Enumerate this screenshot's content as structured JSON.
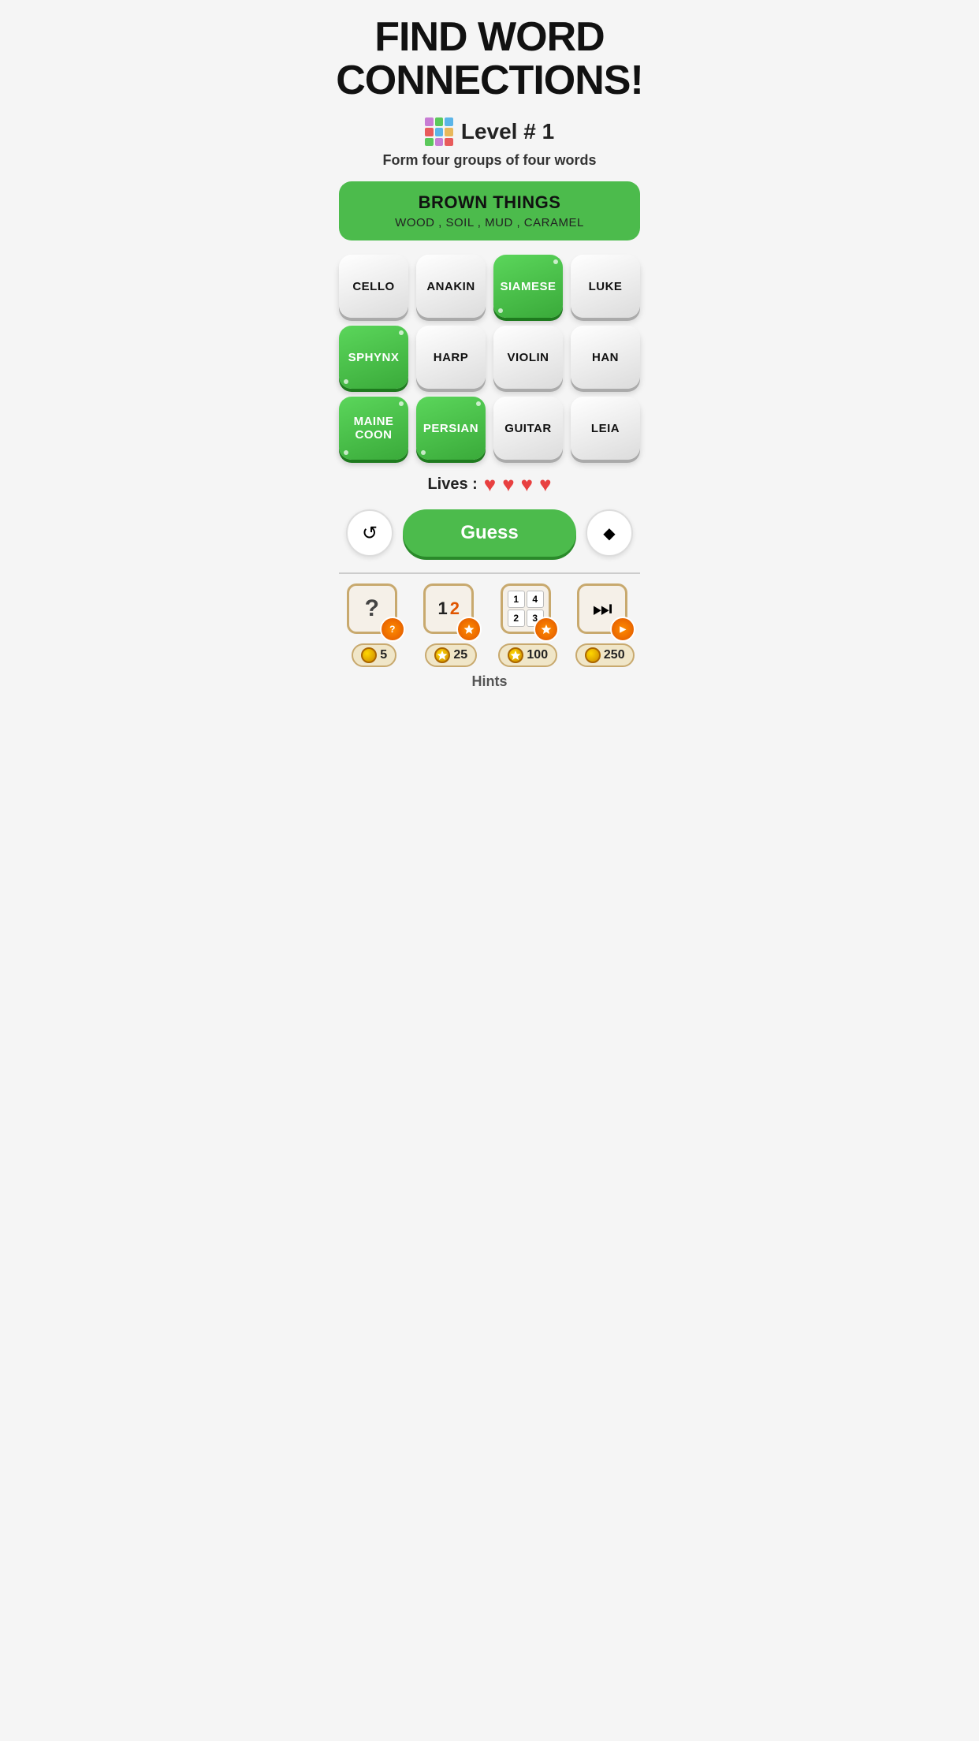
{
  "header": {
    "title": "FIND WORD\nCONNECTIONS!"
  },
  "level": {
    "icon_label": "grid-icon",
    "text": "Level # 1"
  },
  "subtitle": "Form four groups of four words",
  "solved_group": {
    "title": "BROWN THINGS",
    "words": "WOOD , SOIL , MUD , CARAMEL"
  },
  "tiles": [
    {
      "label": "CELLO",
      "selected": false
    },
    {
      "label": "ANAKIN",
      "selected": false
    },
    {
      "label": "SIAMESE",
      "selected": true
    },
    {
      "label": "LUKE",
      "selected": false
    },
    {
      "label": "SPHYNX",
      "selected": true
    },
    {
      "label": "HARP",
      "selected": false
    },
    {
      "label": "VIOLIN",
      "selected": false
    },
    {
      "label": "HAN",
      "selected": false
    },
    {
      "label": "MAINE\nCOON",
      "selected": true
    },
    {
      "label": "PERSIAN",
      "selected": true
    },
    {
      "label": "GUITAR",
      "selected": false
    },
    {
      "label": "LEIA",
      "selected": false
    }
  ],
  "lives": {
    "label": "Lives :",
    "count": 4
  },
  "buttons": {
    "shuffle": "↺",
    "guess": "Guess",
    "erase": "◆"
  },
  "hints": [
    {
      "cost": "5",
      "has_star": false
    },
    {
      "cost": "25",
      "has_star": true
    },
    {
      "cost": "100",
      "has_star": true
    },
    {
      "cost": "250",
      "has_star": false
    }
  ],
  "hints_label": "Hints"
}
